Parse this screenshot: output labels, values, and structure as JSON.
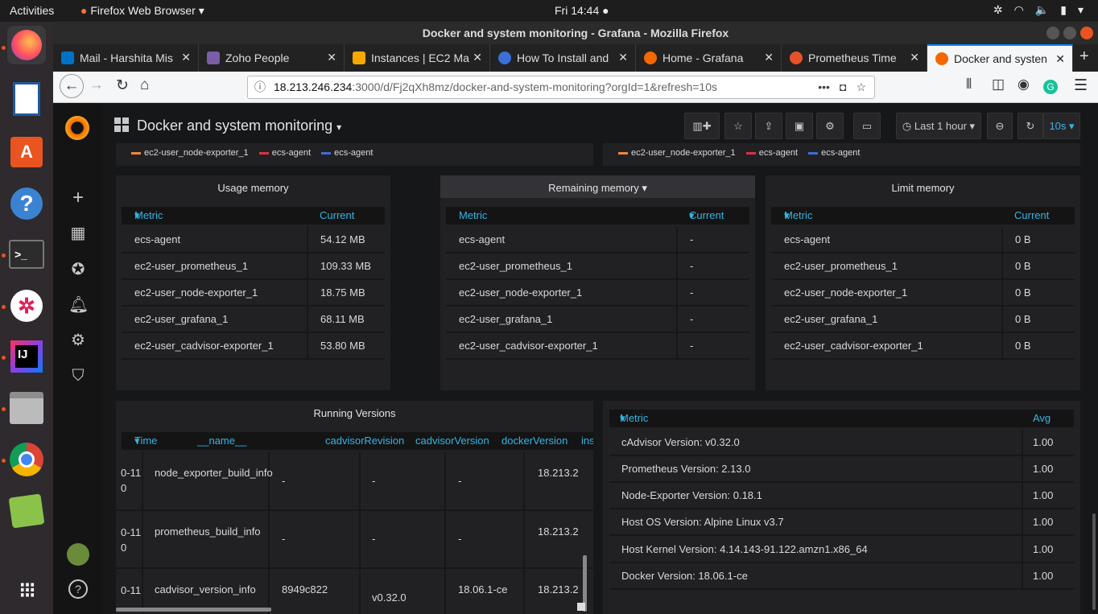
{
  "os": {
    "activities": "Activities",
    "app_menu": "Firefox Web Browser",
    "clock": "Fri 14:44"
  },
  "browser": {
    "window_title": "Docker and system monitoring - Grafana - Mozilla Firefox",
    "tabs": [
      {
        "label": "Mail - Harshita Mis",
        "color": "#0072c6"
      },
      {
        "label": "Zoho People",
        "color": "#7b5ea7"
      },
      {
        "label": "Instances | EC2 Ma",
        "color": "#f7a800"
      },
      {
        "label": "How To Install and",
        "color": "#3a6fd8"
      },
      {
        "label": "Home - Grafana",
        "color": "#f46800"
      },
      {
        "label": "Prometheus Time",
        "color": "#e6522c"
      },
      {
        "label": "Docker and systen",
        "color": "#f46800"
      }
    ],
    "url_host": "18.213.246.234",
    "url_rest": ":3000/d/Fj2qXh8mz/docker-and-system-monitoring?orgId=1&refresh=10s"
  },
  "dashboard": {
    "title": "Docker and system monitoring",
    "time_range": "Last 1 hour",
    "refresh": "10s",
    "legend_left": [
      {
        "name": "ec2-user_node-exporter_1",
        "color": "#f2873a"
      },
      {
        "name": "ecs-agent",
        "color": "#e02f44"
      },
      {
        "name": "ecs-agent",
        "color": "#3f6dd8"
      }
    ],
    "legend_right": [
      {
        "name": "ec2-user_node-exporter_1",
        "color": "#f2873a"
      },
      {
        "name": "ecs-agent",
        "color": "#e02f44"
      },
      {
        "name": "ecs-agent",
        "color": "#3f6dd8"
      }
    ],
    "usage_memory": {
      "title": "Usage memory",
      "col_metric": "Metric",
      "col_current": "Current",
      "rows": [
        {
          "metric": "ecs-agent",
          "value": "54.12 MB"
        },
        {
          "metric": "ec2-user_prometheus_1",
          "value": "109.33 MB"
        },
        {
          "metric": "ec2-user_node-exporter_1",
          "value": "18.75 MB"
        },
        {
          "metric": "ec2-user_grafana_1",
          "value": "68.11 MB"
        },
        {
          "metric": "ec2-user_cadvisor-exporter_1",
          "value": "53.80 MB"
        }
      ]
    },
    "remaining_memory": {
      "title": "Remaining memory",
      "col_metric": "Metric",
      "col_current": "Current",
      "rows": [
        {
          "metric": "ecs-agent",
          "value": "-"
        },
        {
          "metric": "ec2-user_prometheus_1",
          "value": "-"
        },
        {
          "metric": "ec2-user_node-exporter_1",
          "value": "-"
        },
        {
          "metric": "ec2-user_grafana_1",
          "value": "-"
        },
        {
          "metric": "ec2-user_cadvisor-exporter_1",
          "value": "-"
        }
      ]
    },
    "limit_memory": {
      "title": "Limit memory",
      "col_metric": "Metric",
      "col_current": "Current",
      "rows": [
        {
          "metric": "ecs-agent",
          "value": "0 B"
        },
        {
          "metric": "ec2-user_prometheus_1",
          "value": "0 B"
        },
        {
          "metric": "ec2-user_node-exporter_1",
          "value": "0 B"
        },
        {
          "metric": "ec2-user_grafana_1",
          "value": "0 B"
        },
        {
          "metric": "ec2-user_cadvisor-exporter_1",
          "value": "0 B"
        }
      ]
    },
    "running_versions": {
      "title": "Running Versions",
      "columns": [
        "Time",
        "__name__",
        "cadvisorRevision",
        "cadvisorVersion",
        "dockerVersion",
        "ins"
      ],
      "rows": [
        {
          "time_top": "0-11",
          "time_bot": "0",
          "name": "node_exporter_build_info",
          "rev": "-",
          "ver": "-",
          "docker": "-",
          "ins": "18.213.2"
        },
        {
          "time_top": "0-11",
          "time_bot": "0",
          "name": "prometheus_build_info",
          "rev": "-",
          "ver": "-",
          "docker": "-",
          "ins": "18.213.2"
        },
        {
          "time_top": "0-11",
          "time_bot": "",
          "name": "cadvisor_version_info",
          "rev": "8949c822",
          "ver": "v0.32.0",
          "docker": "18.06.1-ce",
          "ins": "18.213.2"
        }
      ]
    },
    "versions_table": {
      "col_metric": "Metric",
      "col_avg": "Avg",
      "rows": [
        {
          "metric": "cAdvisor Version: v0.32.0",
          "value": "1.00"
        },
        {
          "metric": "Prometheus Version: 2.13.0",
          "value": "1.00"
        },
        {
          "metric": "Node-Exporter Version: 0.18.1",
          "value": "1.00"
        },
        {
          "metric": "Host OS Version: Alpine Linux v3.7",
          "value": "1.00"
        },
        {
          "metric": "Host Kernel Version: 4.14.143-91.122.amzn1.x86_64",
          "value": "1.00"
        },
        {
          "metric": "Docker Version: 18.06.1-ce",
          "value": "1.00"
        }
      ]
    }
  }
}
